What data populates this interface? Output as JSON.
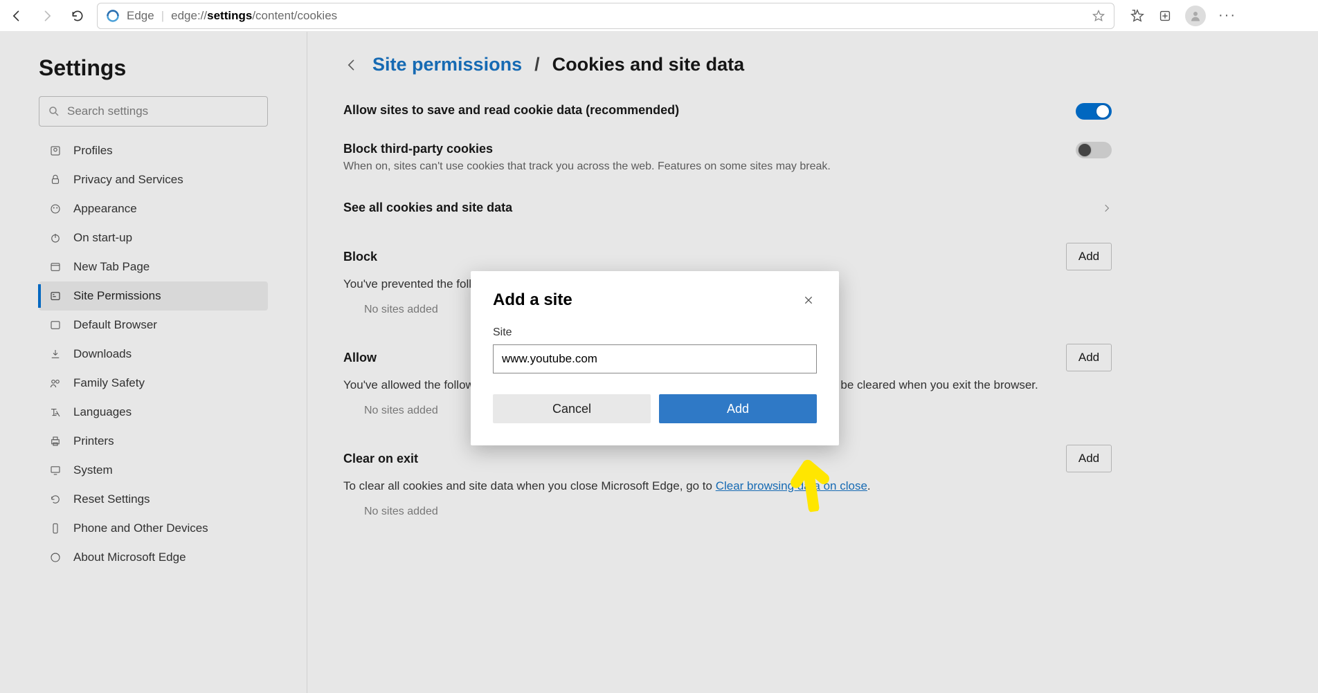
{
  "chrome": {
    "edge_label": "Edge",
    "url_prefix": "edge://",
    "url_bold": "settings",
    "url_rest": "/content/cookies"
  },
  "sidebar": {
    "title": "Settings",
    "search_placeholder": "Search settings",
    "items": [
      {
        "label": "Profiles"
      },
      {
        "label": "Privacy and Services"
      },
      {
        "label": "Appearance"
      },
      {
        "label": "On start-up"
      },
      {
        "label": "New Tab Page"
      },
      {
        "label": "Site Permissions"
      },
      {
        "label": "Default Browser"
      },
      {
        "label": "Downloads"
      },
      {
        "label": "Family Safety"
      },
      {
        "label": "Languages"
      },
      {
        "label": "Printers"
      },
      {
        "label": "System"
      },
      {
        "label": "Reset Settings"
      },
      {
        "label": "Phone and Other Devices"
      },
      {
        "label": "About Microsoft Edge"
      }
    ]
  },
  "breadcrumb": {
    "link": "Site permissions",
    "sep": "/",
    "current": "Cookies and site data"
  },
  "rows": {
    "allow": {
      "title": "Allow sites to save and read cookie data (recommended)"
    },
    "block3p": {
      "title": "Block third-party cookies",
      "sub": "When on, sites can't use cookies that track you across the web. Features on some sites may break."
    },
    "seeall": "See all cookies and site data"
  },
  "lists": {
    "block": {
      "title": "Block",
      "desc": "You've prevented the following sites from saving and reading cookies on your device.",
      "add": "Add",
      "empty": "No sites added"
    },
    "allow": {
      "title": "Allow",
      "desc": "You've allowed the following sites to save cookies on your device. Cookies for these sites won't be cleared when you exit the browser.",
      "add": "Add",
      "empty": "No sites added"
    },
    "clear": {
      "title": "Clear on exit",
      "desc_pre": "To clear all cookies and site data when you close Microsoft Edge, go to ",
      "link": "Clear browsing data on close",
      "desc_post": ".",
      "add": "Add",
      "empty": "No sites added"
    }
  },
  "dialog": {
    "title": "Add a site",
    "label": "Site",
    "value": "www.youtube.com",
    "cancel": "Cancel",
    "add": "Add"
  }
}
